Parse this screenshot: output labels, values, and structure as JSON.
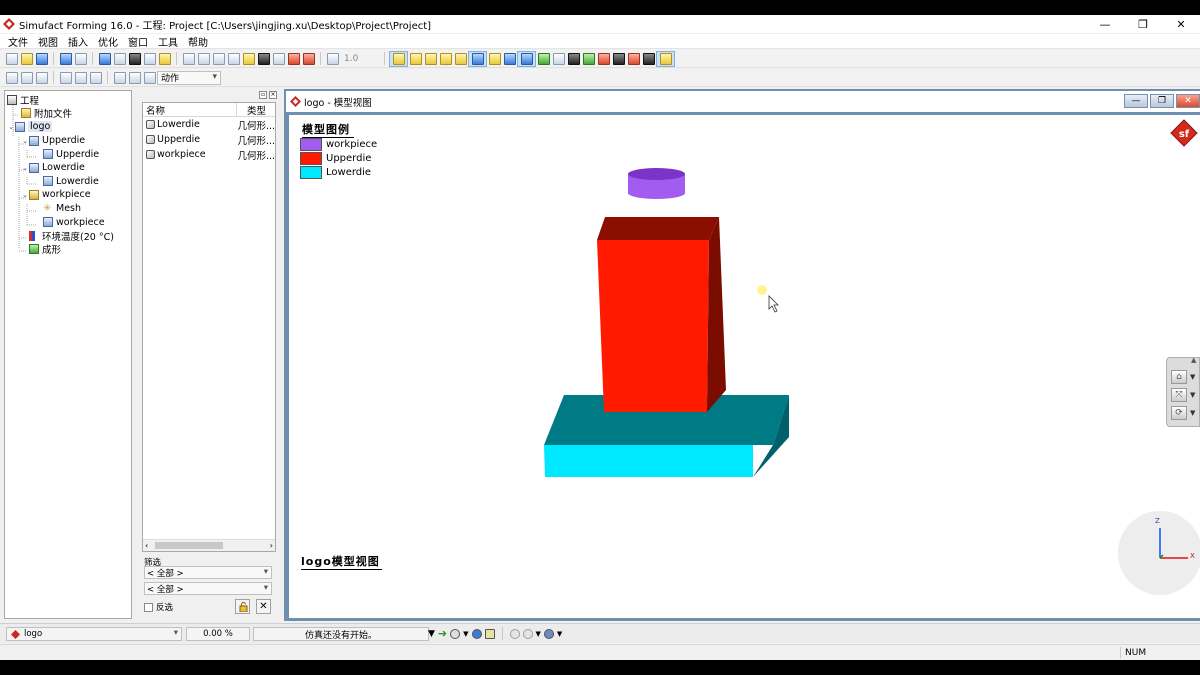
{
  "window": {
    "title": "Simufact Forming 16.0 - 工程:  Project [C:\\Users\\jingjing.xu\\Desktop\\Project\\Project]",
    "minimize": "—",
    "restore": "❐",
    "close": "✕"
  },
  "menu": [
    "文件",
    "视图",
    "插入",
    "优化",
    "窗口",
    "工具",
    "帮助"
  ],
  "toolbar": {
    "zoom_value": "1.0",
    "action_combo": "动作"
  },
  "tree": {
    "root": "工程",
    "items": [
      {
        "label": "附加文件"
      },
      {
        "label": "logo"
      },
      {
        "label": "Upperdie"
      },
      {
        "label": "Upperdie"
      },
      {
        "label": "Lowerdie"
      },
      {
        "label": "Lowerdie"
      },
      {
        "label": "workpiece"
      },
      {
        "label": "Mesh"
      },
      {
        "label": "workpiece"
      },
      {
        "label": "环境温度(20 °C)"
      },
      {
        "label": "成形"
      }
    ]
  },
  "object_list": {
    "col_name": "名称",
    "col_type": "类型",
    "rows": [
      {
        "name": "Lowerdie",
        "type": "几何形..."
      },
      {
        "name": "Upperdie",
        "type": "几何形..."
      },
      {
        "name": "workpiece",
        "type": "几何形..."
      }
    ],
    "filter_label": "筛选",
    "filter1": "< 全部 >",
    "filter2": "< 全部 >",
    "invert_label": "反选"
  },
  "model_view": {
    "title": "logo - 模型视图",
    "legend_title": "模型图例",
    "legend": [
      {
        "label": "workpiece",
        "color": "#a25cf0"
      },
      {
        "label": "Upperdie",
        "color": "#ff1a00"
      },
      {
        "label": "Lowerdie",
        "color": "#00e8ff"
      }
    ],
    "caption": "logo模型视图",
    "axis_z": "Z",
    "axis_x": "X"
  },
  "statusbar": {
    "process": "logo",
    "percent": "0.00 %",
    "status": "仿真还没有开始。",
    "num": "NUM"
  }
}
